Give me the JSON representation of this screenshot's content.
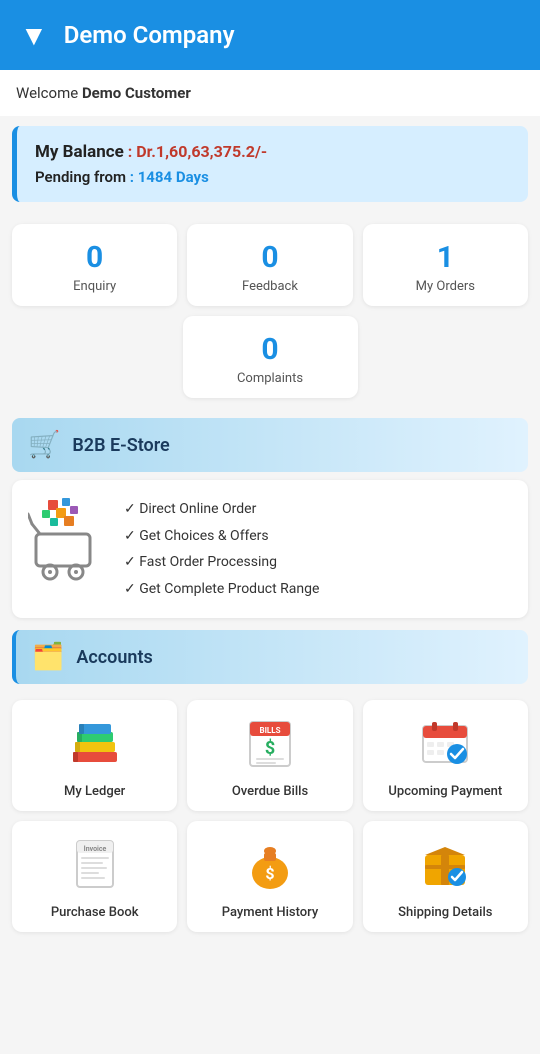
{
  "header": {
    "chevron": "❯",
    "company_name": "Demo Company"
  },
  "welcome": {
    "prefix": "Welcome",
    "customer_name": "Demo Customer"
  },
  "balance": {
    "label": "My Balance",
    "amount": ": Dr.1,60,63,375.2/-",
    "pending_label": "Pending from",
    "pending_value": ": 1484 Days"
  },
  "stats": [
    {
      "id": "enquiry",
      "count": "0",
      "label": "Enquiry"
    },
    {
      "id": "feedback",
      "count": "0",
      "label": "Feedback"
    },
    {
      "id": "my-orders",
      "count": "1",
      "label": "My Orders"
    },
    {
      "id": "complaints",
      "count": "0",
      "label": "Complaints"
    }
  ],
  "b2b": {
    "section_label": "B2B E-Store",
    "features": [
      "Direct Online Order",
      "Get Choices & Offers",
      "Fast Order Processing",
      "Get Complete Product Range"
    ]
  },
  "accounts": {
    "section_label": "Accounts",
    "items_row1": [
      {
        "id": "my-ledger",
        "label": "My Ledger",
        "icon": "📚"
      },
      {
        "id": "overdue-bills",
        "label": "Overdue Bills",
        "icon": "🗒️"
      },
      {
        "id": "upcoming-payment",
        "label": "Upcoming\nPayment",
        "icon": "📅"
      }
    ],
    "items_row2": [
      {
        "id": "purchase-book",
        "label": "Purchase Book",
        "icon": "🧾"
      },
      {
        "id": "payment-history",
        "label": "Payment History",
        "icon": "💰"
      },
      {
        "id": "shipping-details",
        "label": "Shipping Details",
        "icon": "📦"
      }
    ]
  }
}
